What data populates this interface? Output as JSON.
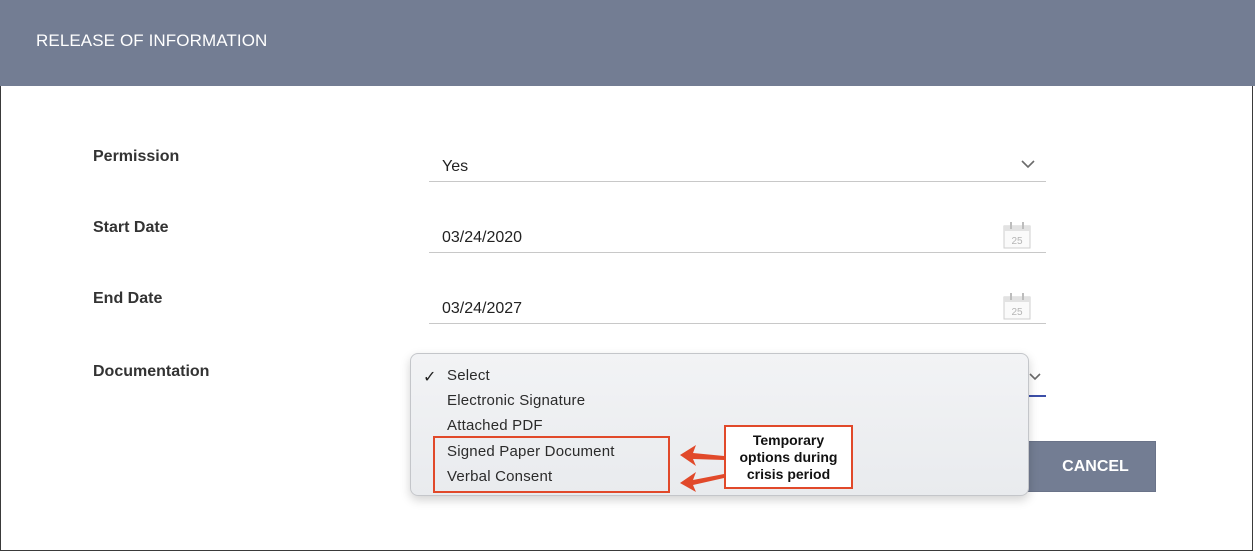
{
  "header": {
    "title": "RELEASE OF INFORMATION"
  },
  "form": {
    "permission": {
      "label": "Permission",
      "value": "Yes"
    },
    "start_date": {
      "label": "Start Date",
      "value": "03/24/2020",
      "calendar_day": "25"
    },
    "end_date": {
      "label": "End Date",
      "value": "03/24/2027",
      "calendar_day": "25"
    },
    "documentation": {
      "label": "Documentation"
    }
  },
  "dropdown": {
    "check": "✓",
    "options": [
      "Select",
      "Electronic Signature",
      "Attached PDF",
      "Signed Paper Document",
      "Verbal Consent"
    ]
  },
  "annotation": {
    "text": "Temporary options during crisis period",
    "color": "#e1492a"
  },
  "buttons": {
    "cancel": "CANCEL"
  },
  "colors": {
    "header": "#737d93",
    "accent_line": "#3c4fa8"
  },
  "icons": {
    "select": "chevron-down-icon",
    "date": "calendar-icon"
  }
}
